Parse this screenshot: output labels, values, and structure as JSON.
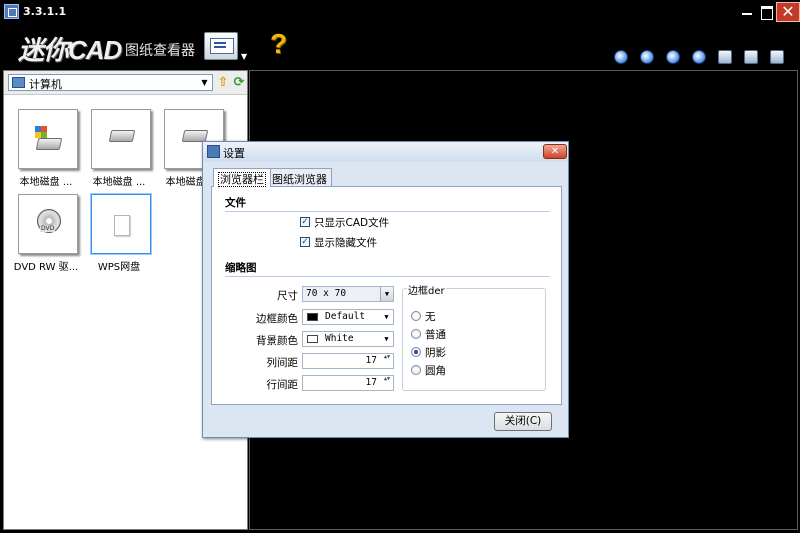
{
  "window": {
    "title": "3.3.1.1",
    "close_glyph": "✕"
  },
  "toolbar": {
    "logo_main": "迷你CAD",
    "logo_sub": "图纸查看器",
    "help_glyph": "?",
    "view_drop_glyph": "▼",
    "icons": [
      "zoom-in-icon",
      "zoom-out-icon",
      "zoom-fit-icon",
      "zoom-window-icon",
      "pan-icon",
      "layers-icon",
      "print-icon"
    ]
  },
  "browser": {
    "location": "计算机",
    "combo_arrow": "▼",
    "up_glyph": "⇧",
    "refresh_glyph": "⟳",
    "items": [
      {
        "label": "本地磁盘 ...",
        "icon": "system-drive-icon"
      },
      {
        "label": "本地磁盘 ...",
        "icon": "hard-drive-icon"
      },
      {
        "label": "本地磁盘 ...",
        "icon": "hard-drive-icon"
      },
      {
        "label": "DVD RW 驱...",
        "icon": "dvd-drive-icon"
      },
      {
        "label": "WPS网盘",
        "icon": "blank-file-icon"
      }
    ]
  },
  "dialog": {
    "title": "设置",
    "close_glyph": "✕",
    "tabs": [
      {
        "label": "浏览器栏"
      },
      {
        "label": "图纸浏览器"
      }
    ],
    "file_section": {
      "title": "文件",
      "options": [
        {
          "label": "只显示CAD文件",
          "checked": true,
          "mark": "✓"
        },
        {
          "label": "显示隐藏文件",
          "checked": true,
          "mark": "✓"
        }
      ]
    },
    "thumb_section": {
      "title": "缩略图",
      "size_label": "尺寸",
      "size_value": "70 x 70",
      "border_color_label": "边框颜色",
      "border_color_value": "Default",
      "border_color_swatch": "#000000",
      "bg_color_label": "背景颜色",
      "bg_color_value": "White",
      "bg_color_swatch": "#ffffff",
      "col_spacing_label": "列间距",
      "col_spacing_value": "17",
      "row_spacing_label": "行间距",
      "row_spacing_value": "17",
      "combo_arrow": "▼",
      "spin_glyph": "▲▼"
    },
    "border_group": {
      "title": "边框der",
      "options": [
        {
          "label": "无",
          "checked": false
        },
        {
          "label": "普通",
          "checked": false
        },
        {
          "label": "阴影",
          "checked": true
        },
        {
          "label": "圆角",
          "checked": false
        }
      ]
    },
    "close_button": "关闭(C)"
  },
  "colors": {
    "background": "#000000",
    "dialog_bg": "#dce6f2",
    "panel_bg": "#ffffff",
    "accent": "#1f4f98"
  }
}
